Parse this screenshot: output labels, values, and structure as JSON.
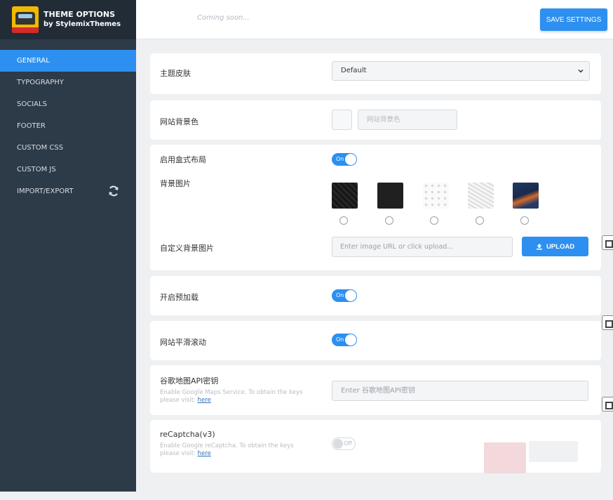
{
  "brand": {
    "title": "THEME OPTIONS",
    "subtitle": "by StylemixThemes",
    "logo_icon": "car-logo-icon"
  },
  "sidebar": {
    "items": [
      {
        "label": "GENERAL",
        "active": true
      },
      {
        "label": "TYPOGRAPHY"
      },
      {
        "label": "SOCIALS"
      },
      {
        "label": "FOOTER"
      },
      {
        "label": "CUSTOM CSS"
      },
      {
        "label": "CUSTOM JS"
      },
      {
        "label": "IMPORT/EXPORT",
        "icon": "sync-icon"
      }
    ]
  },
  "topbar": {
    "coming_soon": "Coming soon...",
    "save_label": "SAVE SETTINGS"
  },
  "settings": {
    "skin": {
      "label": "主题皮肤",
      "value": "Default"
    },
    "bg_color": {
      "label": "网站背景色",
      "placeholder": "网站背景色"
    },
    "boxed_layout": {
      "label": "启用盒式布局",
      "toggle": "On"
    },
    "bg_image": {
      "label": "背景图片"
    },
    "custom_bg": {
      "label": "自定义背景图片",
      "placeholder": "Enter image URL or click upload...",
      "upload_label": "UPLOAD"
    },
    "preloader": {
      "label": "开启预加载",
      "toggle": "On"
    },
    "smooth_scroll": {
      "label": "网站平滑滚动",
      "toggle": "On"
    },
    "google_maps": {
      "label": "谷歌地图API密钥",
      "help": "Enable Google Maps Service. To obtain the keys please visit:",
      "link": "here",
      "placeholder": "Enter 谷歌地图API密钥"
    },
    "recaptcha": {
      "label": "reCaptcha(v3)",
      "help": "Enable Google reCaptcha. To obtain the keys please visit:",
      "link": "here",
      "toggle": "Off"
    }
  },
  "colors": {
    "accent": "#2d8ff0",
    "sidebar_bg": "#2d3a47",
    "brand_bg": "#222c37"
  }
}
